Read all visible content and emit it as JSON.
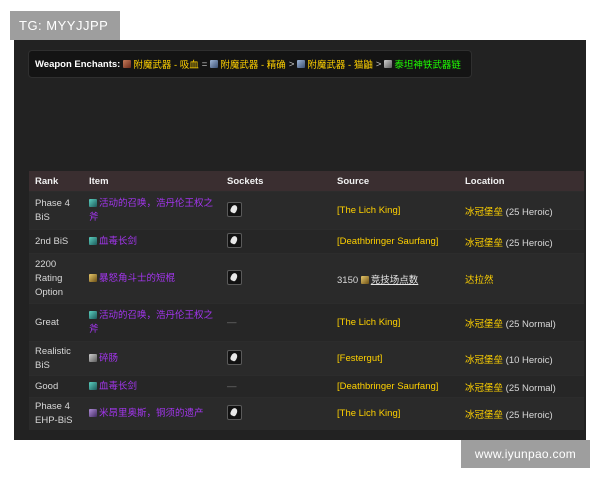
{
  "watermark_top": "TG: MYYJJPP",
  "watermark_bottom": "www.iyunpao.com",
  "enchants": {
    "label": "Weapon Enchants:",
    "steps": [
      {
        "icon": "red-enchant-icon",
        "text": "附魔武器 - 吸血"
      },
      {
        "sep": "="
      },
      {
        "icon": "blue-enchant-icon",
        "text": "附魔武器 - 精确"
      },
      {
        "sep": ">"
      },
      {
        "icon": "blue-enchant-icon",
        "text": "附魔武器 - 猫鼬"
      },
      {
        "sep": ">"
      },
      {
        "icon": "chain-icon",
        "text": "泰坦神铁武器链"
      }
    ]
  },
  "table": {
    "headers": [
      "Rank",
      "Item",
      "Sockets",
      "Source",
      "Location"
    ],
    "rows": [
      {
        "rank": "Phase 4 BiS",
        "item": "活动的召唤，浩丹伦王权之斧",
        "icon": "teal",
        "socket": true,
        "source": "[The Lich King]",
        "source_plain": false,
        "location": "冰冠堡垒",
        "location_note": "(25 Heroic)"
      },
      {
        "rank": "2nd BiS",
        "item": "血毒长剑",
        "icon": "teal",
        "socket": true,
        "source": "[Deathbringer Saurfang]",
        "source_plain": false,
        "location": "冰冠堡垒",
        "location_note": "(25 Heroic)"
      },
      {
        "rank": "2200 Rating Option",
        "item": "暴怒角斗士的短棍",
        "icon": "gold",
        "socket": true,
        "source": "3150",
        "source_plain": true,
        "points": "竞技场点数",
        "location": "达拉然",
        "location_note": ""
      },
      {
        "rank": "Great",
        "item": "活动的召唤，浩丹伦王权之斧",
        "icon": "teal",
        "socket": false,
        "source": "[The Lich King]",
        "source_plain": false,
        "location": "冰冠堡垒",
        "location_note": "(25 Normal)"
      },
      {
        "rank": "Realistic BiS",
        "item": "碎肠",
        "icon": "gray",
        "socket": true,
        "source": "[Festergut]",
        "source_plain": false,
        "location": "冰冠堡垒",
        "location_note": "(10 Heroic)"
      },
      {
        "rank": "Good",
        "item": "血毒长剑",
        "icon": "teal",
        "socket": false,
        "source": "[Deathbringer Saurfang]",
        "source_plain": false,
        "location": "冰冠堡垒",
        "location_note": "(25 Normal)"
      },
      {
        "rank": "Phase 4 EHP-BiS",
        "item": "米昂里奥斯，铜须的遗产",
        "icon": "purple",
        "socket": true,
        "source": "[The Lich King]",
        "source_plain": false,
        "location": "冰冠堡垒",
        "location_note": "(25 Heroic)"
      }
    ]
  }
}
